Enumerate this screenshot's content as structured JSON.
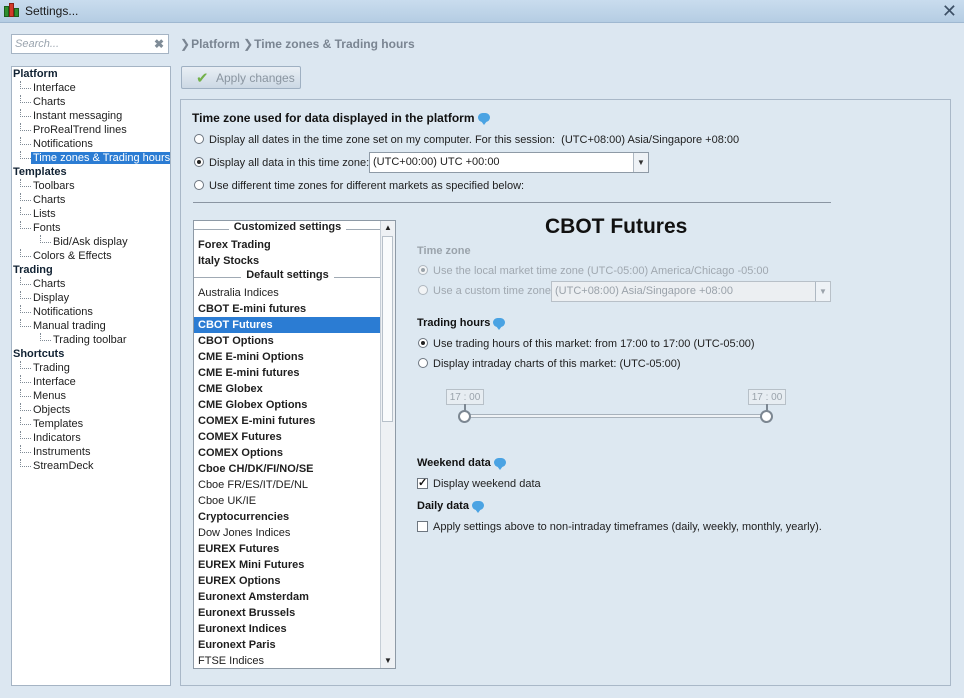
{
  "window": {
    "title": "Settings..."
  },
  "search": {
    "placeholder": "Search..."
  },
  "breadcrumb": {
    "items": [
      "Platform",
      "Time zones & Trading hours"
    ]
  },
  "toolbar": {
    "apply_label": "Apply changes"
  },
  "tree": {
    "sections": [
      {
        "label": "Platform",
        "items": [
          {
            "label": "Interface"
          },
          {
            "label": "Charts"
          },
          {
            "label": "Instant messaging"
          },
          {
            "label": "ProRealTrend lines"
          },
          {
            "label": "Notifications"
          },
          {
            "label": "Time zones & Trading hours",
            "selected": true
          }
        ]
      },
      {
        "label": "Templates",
        "items": [
          {
            "label": "Toolbars"
          },
          {
            "label": "Charts"
          },
          {
            "label": "Lists"
          },
          {
            "label": "Fonts"
          },
          {
            "label": "Bid/Ask display",
            "sub": true
          },
          {
            "label": "Colors & Effects"
          }
        ]
      },
      {
        "label": "Trading",
        "items": [
          {
            "label": "Charts"
          },
          {
            "label": "Display"
          },
          {
            "label": "Notifications"
          },
          {
            "label": "Manual trading"
          },
          {
            "label": "Trading toolbar",
            "sub": true
          }
        ]
      },
      {
        "label": "Shortcuts",
        "items": [
          {
            "label": "Trading"
          },
          {
            "label": "Interface"
          },
          {
            "label": "Menus"
          },
          {
            "label": "Objects"
          },
          {
            "label": "Templates"
          },
          {
            "label": "Indicators"
          },
          {
            "label": "Instruments"
          },
          {
            "label": "StreamDeck"
          }
        ]
      }
    ]
  },
  "timezone": {
    "heading": "Time zone used for data displayed in the platform",
    "option_computer_text": "Display all dates in the time zone set on my computer. For this session:",
    "option_computer_value": "(UTC+08:00) Asia/Singapore +08:00",
    "option_fixed_text": "Display all data in this time zone:",
    "fixed_select_value": "(UTC+00:00) UTC +00:00",
    "option_markets_text": "Use different time zones for different markets as specified below:"
  },
  "market_list": {
    "custom_header": "Customized settings",
    "custom_items": [
      "Forex Trading",
      "Italy Stocks"
    ],
    "default_header": "Default settings",
    "default_items": [
      {
        "label": "Australia Indices",
        "bold": false
      },
      {
        "label": "CBOT E-mini futures",
        "bold": true
      },
      {
        "label": "CBOT Futures",
        "bold": true,
        "selected": true
      },
      {
        "label": "CBOT Options",
        "bold": true
      },
      {
        "label": "CME E-mini Options",
        "bold": true
      },
      {
        "label": "CME E-mini futures",
        "bold": true
      },
      {
        "label": "CME Globex",
        "bold": true
      },
      {
        "label": "CME Globex Options",
        "bold": true
      },
      {
        "label": "COMEX E-mini futures",
        "bold": true
      },
      {
        "label": "COMEX Futures",
        "bold": true
      },
      {
        "label": "COMEX Options",
        "bold": true
      },
      {
        "label": "Cboe CH/DK/FI/NO/SE",
        "bold": true
      },
      {
        "label": "Cboe FR/ES/IT/DE/NL",
        "bold": false
      },
      {
        "label": "Cboe UK/IE",
        "bold": false
      },
      {
        "label": "Cryptocurrencies",
        "bold": true
      },
      {
        "label": "Dow Jones Indices",
        "bold": false
      },
      {
        "label": "EUREX Futures",
        "bold": true
      },
      {
        "label": "EUREX Mini Futures",
        "bold": true
      },
      {
        "label": "EUREX Options",
        "bold": true
      },
      {
        "label": "Euronext Amsterdam",
        "bold": true
      },
      {
        "label": "Euronext Brussels",
        "bold": true
      },
      {
        "label": "Euronext Indices",
        "bold": true
      },
      {
        "label": "Euronext Paris",
        "bold": true
      },
      {
        "label": "FTSE Indices",
        "bold": false
      }
    ]
  },
  "detail": {
    "market_title": "CBOT Futures",
    "timezone_heading": "Time zone",
    "local_tz_text": "Use the local market time zone (UTC-05:00) America/Chicago -05:00",
    "custom_tz_text": "Use a custom time zone:",
    "custom_tz_value": "(UTC+08:00) Asia/Singapore +08:00",
    "trading_hours_heading": "Trading hours",
    "use_hours_text": "Use trading hours of this market: from 17:00 to 17:00  (UTC-05:00)",
    "intraday_text": "Display intraday charts of this market:  (UTC-05:00)",
    "slider_start": "17 : 00",
    "slider_end": "17 : 00",
    "weekend_heading": "Weekend data",
    "weekend_text": "Display weekend data",
    "daily_heading": "Daily data",
    "daily_text": "Apply settings above to non-intraday timeframes (daily, weekly, monthly, yearly)."
  },
  "colors": {
    "accent": "#2b7cd3",
    "background": "#dce7f1",
    "info_bubble": "#4aa3e3"
  }
}
